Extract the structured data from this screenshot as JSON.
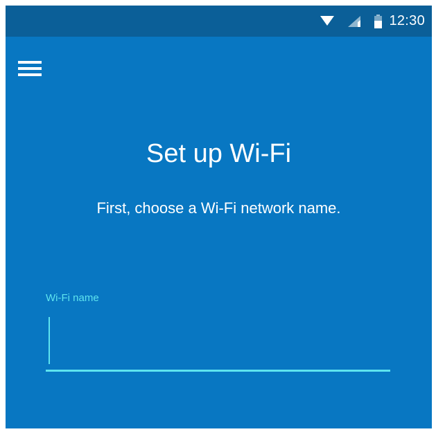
{
  "status_bar": {
    "time": "12:30",
    "icons": [
      "wifi-icon",
      "cell-signal-icon",
      "battery-icon"
    ]
  },
  "app_bar": {
    "menu_icon": "hamburger-menu-icon"
  },
  "main": {
    "title": "Set up Wi-Fi",
    "subtitle": "First, choose a Wi-Fi network name.",
    "wifi_field": {
      "label": "Wi-Fi name",
      "value": ""
    }
  },
  "colors": {
    "background": "#0877c2",
    "status_bar": "#0b5f98",
    "accent": "#5ee4ef",
    "text": "#ffffff"
  }
}
